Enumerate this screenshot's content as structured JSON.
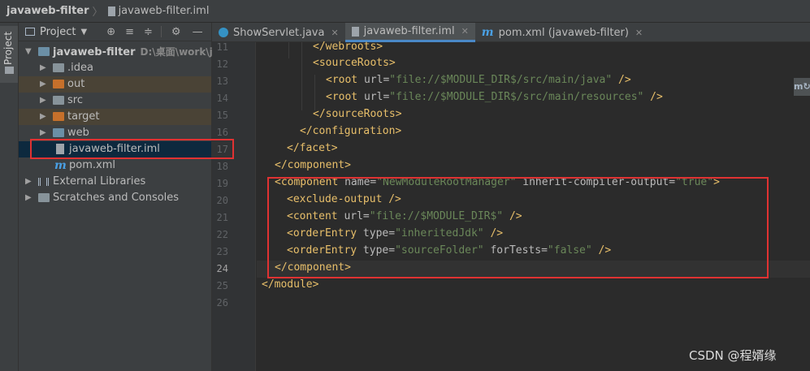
{
  "breadcrumb": {
    "project": "javaweb-filter",
    "file": "javaweb-filter.iml"
  },
  "side_strip": {
    "label": "Project"
  },
  "project_panel": {
    "title": "Project",
    "tree": [
      {
        "label": "javaweb-filter",
        "path": "D:\\桌面\\work\\java",
        "icon": "module-folder-icon"
      },
      {
        "label": ".idea",
        "icon": "folder-icon"
      },
      {
        "label": "out",
        "icon": "folder-orange-icon"
      },
      {
        "label": "src",
        "icon": "folder-icon"
      },
      {
        "label": "target",
        "icon": "folder-orange-icon"
      },
      {
        "label": "web",
        "icon": "web-folder-icon"
      },
      {
        "label": "javaweb-filter.iml",
        "icon": "iml-file-icon"
      },
      {
        "label": "pom.xml",
        "icon": "maven-icon"
      },
      {
        "label": "External Libraries",
        "icon": "libraries-icon"
      },
      {
        "label": "Scratches and Consoles",
        "icon": "scratches-icon"
      }
    ]
  },
  "tabs": [
    {
      "label": "ShowServlet.java",
      "icon": "java-class-icon"
    },
    {
      "label": "javaweb-filter.iml",
      "icon": "iml-file-icon",
      "active": true
    },
    {
      "label": "pom.xml (javaweb-filter)",
      "icon": "maven-icon"
    }
  ],
  "editor": {
    "line_numbers": [
      "11",
      "12",
      "13",
      "14",
      "15",
      "16",
      "17",
      "18",
      "19",
      "20",
      "21",
      "22",
      "23",
      "24",
      "25",
      "26"
    ],
    "current_line": "24"
  },
  "watermark": "CSDN @程婿缘",
  "colors": {
    "highlight_box": "#e03232",
    "tag": "#e8bf6a",
    "string": "#6a8759",
    "attr": "#bababa"
  }
}
